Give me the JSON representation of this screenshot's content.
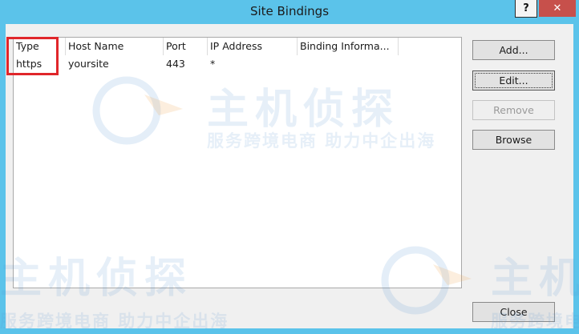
{
  "window": {
    "title": "Site Bindings",
    "help_label": "?",
    "close_label": "✕"
  },
  "list": {
    "columns": [
      "Type",
      "Host Name",
      "Port",
      "IP Address",
      "Binding Informa..."
    ],
    "rows": [
      {
        "type": "https",
        "host": "yoursite",
        "port": "443",
        "ip": "*",
        "binding": ""
      }
    ]
  },
  "buttons": {
    "add": "Add...",
    "edit": "Edit...",
    "remove": "Remove",
    "browse": "Browse",
    "close": "Close"
  },
  "watermark": {
    "brand": "主机侦探",
    "slogan": "服务跨境电商 助力中企出海"
  },
  "colors": {
    "titlebar": "#5bc3ea",
    "close_button": "#c7504b",
    "highlight": "#e0262a"
  }
}
